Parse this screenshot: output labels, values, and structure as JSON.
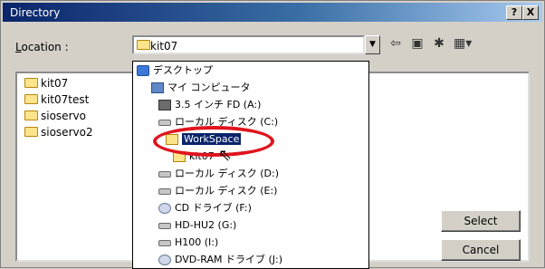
{
  "window": {
    "title": "Directory",
    "help_label": "?",
    "close_label": "X"
  },
  "location": {
    "label_prefix": "L",
    "label_rest": "ocation :",
    "value": "kit07"
  },
  "toolbar": {
    "back_icon": "back-arrow-icon",
    "up_icon": "up-folder-icon",
    "new_folder_icon": "new-folder-icon",
    "view_icon": "view-menu-icon"
  },
  "folders": [
    {
      "label": "kit07"
    },
    {
      "label": "kit07test"
    },
    {
      "label": "sioservo"
    },
    {
      "label": "sioservo2"
    }
  ],
  "dropdown": [
    {
      "label": "デスクトップ",
      "icon": "desktop-icon"
    },
    {
      "label": "マイ コンピュータ",
      "icon": "computer-icon"
    },
    {
      "label": "3.5 インチ FD (A:)",
      "icon": "floppy-icon"
    },
    {
      "label": "ローカル ディスク (C:)",
      "icon": "drive-icon"
    },
    {
      "label": "WorkSpace",
      "icon": "folder-icon",
      "selected": true
    },
    {
      "label": "kit07",
      "icon": "folder-icon"
    },
    {
      "label": "ローカル ディスク (D:)",
      "icon": "drive-icon"
    },
    {
      "label": "ローカル ディスク (E:)",
      "icon": "drive-icon"
    },
    {
      "label": "CD ドライブ (F:)",
      "icon": "cd-icon"
    },
    {
      "label": "HD-HU2 (G:)",
      "icon": "drive-icon"
    },
    {
      "label": "H100 (I:)",
      "icon": "drive-icon"
    },
    {
      "label": "DVD-RAM ドライブ (J:)",
      "icon": "cd-icon"
    }
  ],
  "buttons": {
    "select": "Select",
    "cancel": "Cancel"
  },
  "colors": {
    "highlight": "#0a246a",
    "annotation": "#e0141e"
  }
}
